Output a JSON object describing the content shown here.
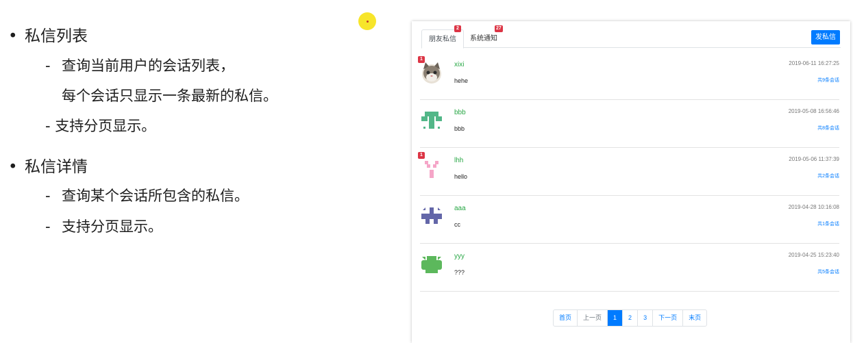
{
  "slide": {
    "bullets": [
      {
        "title": "私信列表",
        "subs": [
          "查询当前用户的会话列表，",
          "每个会话只显示一条最新的私信。",
          "支持分页显示。"
        ]
      },
      {
        "title": "私信详情",
        "subs": [
          "查询某个会话所包含的私信。",
          "支持分页显示。"
        ]
      }
    ],
    "bullet_char": "•",
    "dash_char": "-"
  },
  "panel": {
    "tabs": [
      {
        "label": "朋友私信",
        "badge": "2"
      },
      {
        "label": "系统通知",
        "badge": "27"
      }
    ],
    "send_button": "发私信",
    "messages": [
      {
        "name": "xixi",
        "content": "hehe",
        "time": "2019-06-11 16:27:25",
        "count": "共9条会话",
        "unread": "1",
        "avatar": "cat-avatar"
      },
      {
        "name": "bbb",
        "content": "bbb",
        "time": "2019-05-08 16:56:46",
        "count": "共8条会话",
        "unread": "",
        "avatar": "identicon-green"
      },
      {
        "name": "lhh",
        "content": "hello",
        "time": "2019-05-06 11:37:39",
        "count": "共2条会话",
        "unread": "1",
        "avatar": "identicon-pink"
      },
      {
        "name": "aaa",
        "content": "cc",
        "time": "2019-04-28 10:16:08",
        "count": "共1条会话",
        "unread": "",
        "avatar": "identicon-purple"
      },
      {
        "name": "yyy",
        "content": "???",
        "time": "2019-04-25 15:23:40",
        "count": "共5条会话",
        "unread": "",
        "avatar": "identicon-lime"
      }
    ],
    "pagination": {
      "first": "首页",
      "prev": "上一页",
      "pages": [
        "1",
        "2",
        "3"
      ],
      "current": "1",
      "next": "下一页",
      "last": "末页"
    },
    "colors": {
      "accent": "#007bff",
      "username": "#28a745",
      "badge": "#dc3545"
    }
  }
}
